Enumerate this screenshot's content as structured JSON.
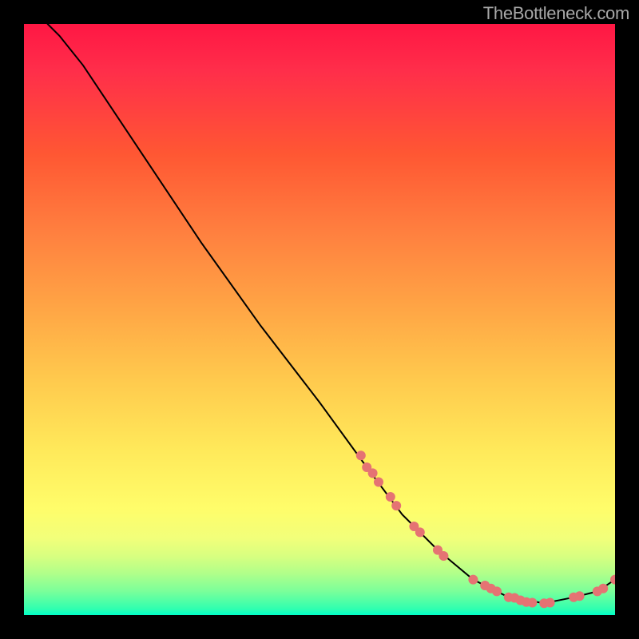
{
  "watermark": "TheBottleneck.com",
  "chart_data": {
    "type": "line",
    "title": "",
    "xlabel": "",
    "ylabel": "",
    "xlim": [
      0,
      100
    ],
    "ylim": [
      0,
      100
    ],
    "curve": [
      {
        "x": 4,
        "y": 100
      },
      {
        "x": 6,
        "y": 98
      },
      {
        "x": 10,
        "y": 93
      },
      {
        "x": 14,
        "y": 87
      },
      {
        "x": 20,
        "y": 78
      },
      {
        "x": 30,
        "y": 63
      },
      {
        "x": 40,
        "y": 49
      },
      {
        "x": 50,
        "y": 36
      },
      {
        "x": 58,
        "y": 25
      },
      {
        "x": 64,
        "y": 17
      },
      {
        "x": 70,
        "y": 11
      },
      {
        "x": 76,
        "y": 6
      },
      {
        "x": 82,
        "y": 3
      },
      {
        "x": 88,
        "y": 2
      },
      {
        "x": 93,
        "y": 3
      },
      {
        "x": 97,
        "y": 4
      },
      {
        "x": 100,
        "y": 6
      }
    ],
    "markers": [
      {
        "x": 57,
        "y": 27
      },
      {
        "x": 58,
        "y": 25
      },
      {
        "x": 59,
        "y": 24
      },
      {
        "x": 60,
        "y": 22.5
      },
      {
        "x": 62,
        "y": 20
      },
      {
        "x": 63,
        "y": 18.5
      },
      {
        "x": 66,
        "y": 15
      },
      {
        "x": 67,
        "y": 14
      },
      {
        "x": 70,
        "y": 11
      },
      {
        "x": 71,
        "y": 10
      },
      {
        "x": 76,
        "y": 6
      },
      {
        "x": 78,
        "y": 5
      },
      {
        "x": 79,
        "y": 4.5
      },
      {
        "x": 80,
        "y": 4
      },
      {
        "x": 82,
        "y": 3
      },
      {
        "x": 83,
        "y": 2.9
      },
      {
        "x": 84,
        "y": 2.5
      },
      {
        "x": 85,
        "y": 2.2
      },
      {
        "x": 86,
        "y": 2.1
      },
      {
        "x": 88,
        "y": 2
      },
      {
        "x": 89,
        "y": 2.1
      },
      {
        "x": 93,
        "y": 3
      },
      {
        "x": 94,
        "y": 3.2
      },
      {
        "x": 97,
        "y": 4
      },
      {
        "x": 98,
        "y": 4.5
      },
      {
        "x": 100,
        "y": 6
      }
    ],
    "marker_color": "#e57373"
  }
}
